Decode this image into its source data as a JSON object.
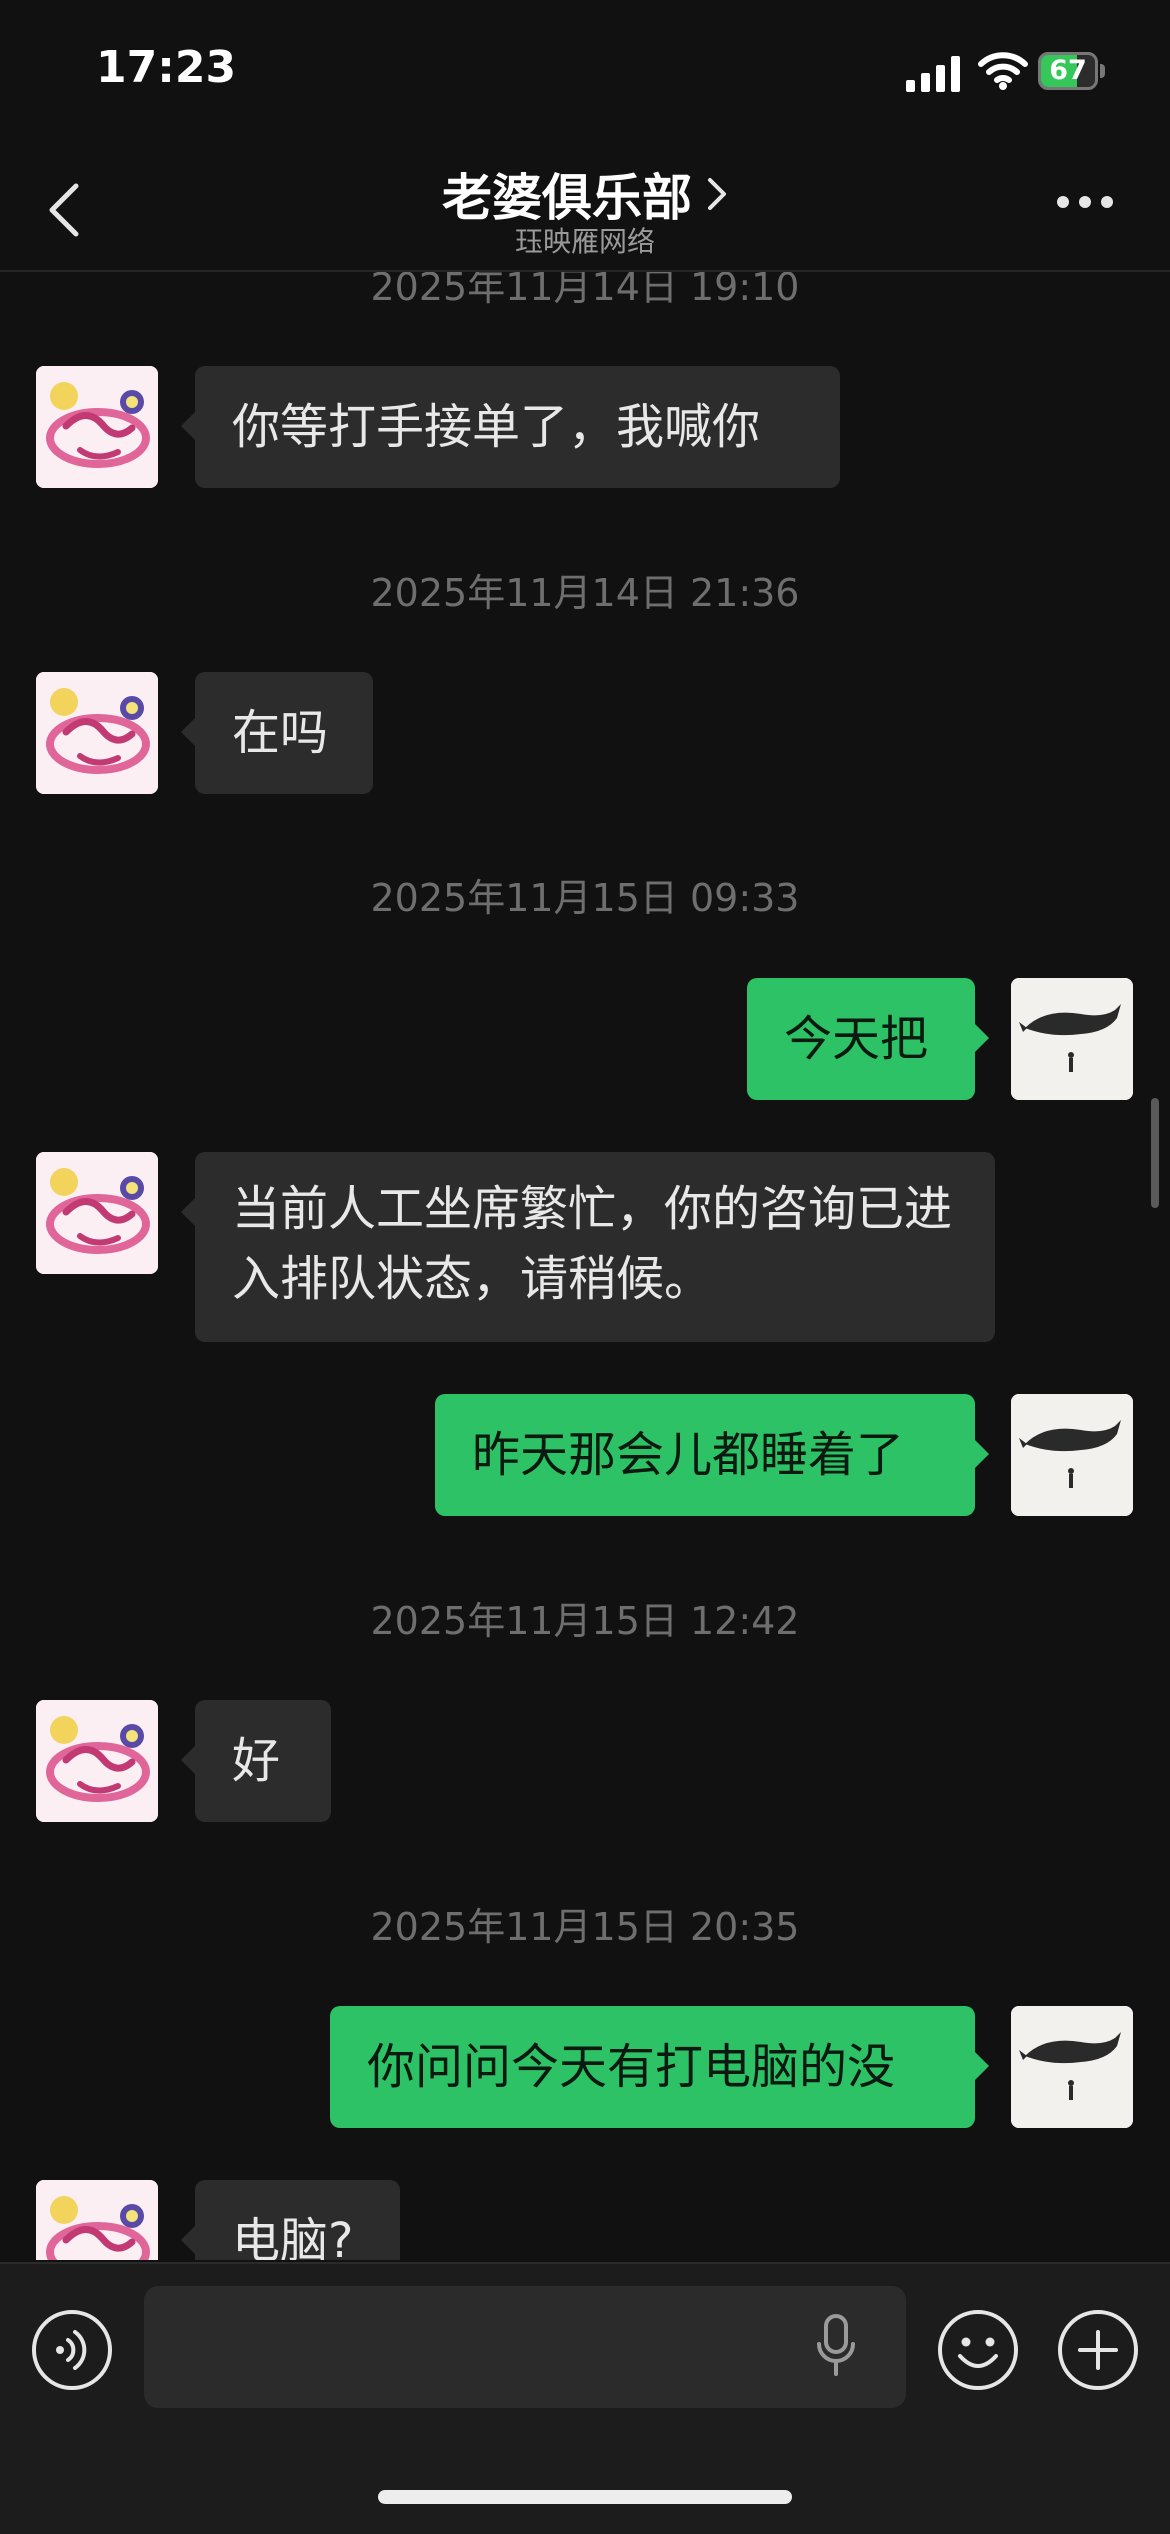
{
  "status_bar": {
    "time": "17:23",
    "battery": "67",
    "battery_level": 0.67,
    "charging": true
  },
  "header": {
    "back_icon": "chevron-left-icon",
    "title": "老婆俱乐部",
    "subtitle": "珏映雁网络",
    "more_icon": "more-dots-icon"
  },
  "messages": [
    {
      "type": "timestamp",
      "text": "2025年11月14日 19:10"
    },
    {
      "type": "in",
      "text": "你等打手接单了，我喊你"
    },
    {
      "type": "timestamp",
      "text": "2025年11月14日 21:36"
    },
    {
      "type": "in",
      "text": "在吗"
    },
    {
      "type": "timestamp",
      "text": "2025年11月15日 09:33"
    },
    {
      "type": "out",
      "text": "今天把"
    },
    {
      "type": "in",
      "text": "当前人工坐席繁忙，你的咨询已进入排队状态，请稍候。"
    },
    {
      "type": "out",
      "text": "昨天那会儿都睡着了"
    },
    {
      "type": "timestamp",
      "text": "2025年11月15日 12:42"
    },
    {
      "type": "in",
      "text": "好"
    },
    {
      "type": "timestamp",
      "text": "2025年11月15日 20:35"
    },
    {
      "type": "out",
      "text": "你问问今天有打电脑的没"
    },
    {
      "type": "in",
      "text": "电脑?"
    }
  ],
  "input_bar": {
    "placeholder": "",
    "voice_icon": "voice-icon",
    "mic_icon": "microphone-icon",
    "emoji_icon": "emoji-icon",
    "plus_icon": "plus-icon"
  },
  "colors": {
    "background": "#111111",
    "incoming_bubble": "#2c2c2c",
    "outgoing_bubble": "#2ec266",
    "timestamp": "#6e6e6e"
  }
}
